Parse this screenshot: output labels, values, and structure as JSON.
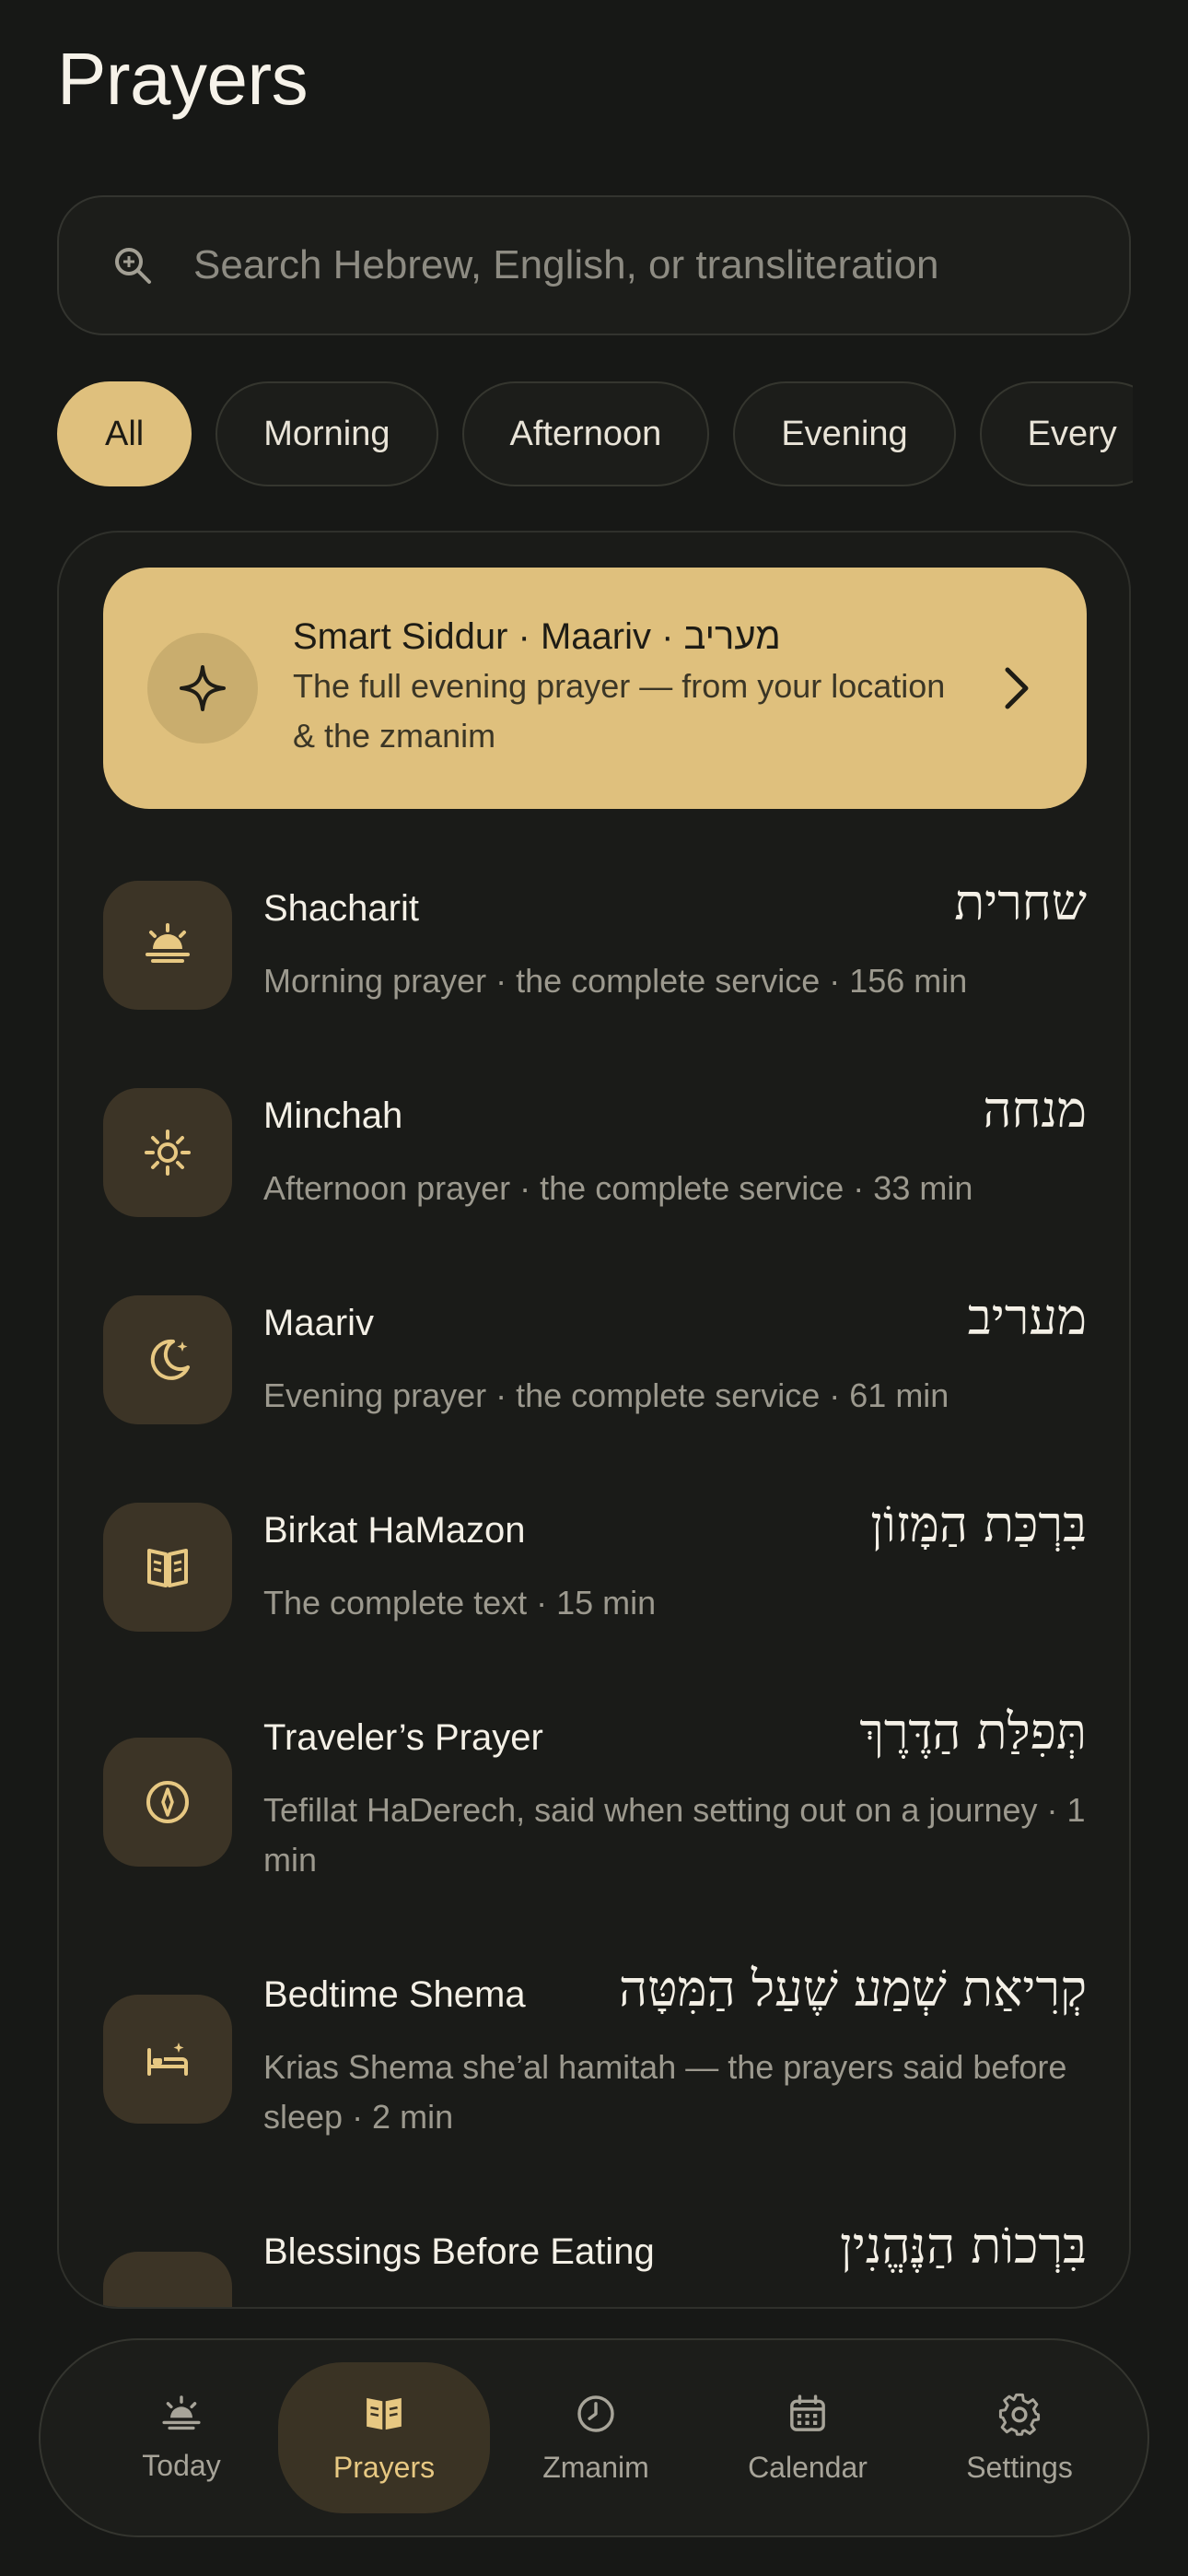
{
  "header": {
    "title": "Prayers"
  },
  "search": {
    "placeholder": "Search Hebrew, English, or transliteration",
    "icon": "search-icon"
  },
  "filters": [
    {
      "label": "All",
      "active": true
    },
    {
      "label": "Morning",
      "active": false
    },
    {
      "label": "Afternoon",
      "active": false
    },
    {
      "label": "Evening",
      "active": false
    },
    {
      "label": "Every",
      "active": false
    }
  ],
  "smart_siddur": {
    "title": "Smart Siddur · Maariv · מעריב",
    "subtitle": "The full evening prayer — from your location & the zmanim",
    "icon": "sparkle-icon"
  },
  "prayers": [
    {
      "name": "Shacharit",
      "hebrew": "שחרית",
      "subtitle": "Morning prayer · the complete service · 156 min",
      "icon": "sunrise-icon"
    },
    {
      "name": "Minchah",
      "hebrew": "מנחה",
      "subtitle": "Afternoon prayer · the complete service · 33 min",
      "icon": "sun-icon"
    },
    {
      "name": "Maariv",
      "hebrew": "מעריב",
      "subtitle": "Evening prayer · the complete service · 61 min",
      "icon": "moon-icon"
    },
    {
      "name": "Birkat HaMazon",
      "hebrew": "בִּרְכַּת הַמָּזוֹן",
      "subtitle": "The complete text · 15 min",
      "icon": "book-icon"
    },
    {
      "name": "Traveler’s Prayer",
      "hebrew": "תְּפִלַּת הַדֶּרֶךְ",
      "subtitle": "Tefillat HaDerech, said when setting out on a journey · 1 min",
      "icon": "compass-icon"
    },
    {
      "name": "Bedtime Shema",
      "hebrew": "קְרִיאַת שְׁמַע שֶׁעַל הַמִּטָּה",
      "subtitle": "Krias Shema she’al hamitah — the prayers said before sleep · 2 min",
      "icon": "bed-icon"
    },
    {
      "name": "Blessings Before Eating",
      "hebrew": "בִּרְכוֹת הַנֶּהֱנִין",
      "subtitle": "",
      "icon": "bread-icon"
    }
  ],
  "tabs": [
    {
      "label": "Today",
      "icon": "sunrise-icon",
      "active": false
    },
    {
      "label": "Prayers",
      "icon": "book-icon",
      "active": true
    },
    {
      "label": "Zmanim",
      "icon": "clock-icon",
      "active": false
    },
    {
      "label": "Calendar",
      "icon": "calendar-icon",
      "active": false
    },
    {
      "label": "Settings",
      "icon": "gear-icon",
      "active": false
    }
  ],
  "colors": {
    "background": "#171816",
    "accent": "#dfc07d",
    "icon_tile": "#3c3426",
    "muted_text": "#9c998e"
  }
}
